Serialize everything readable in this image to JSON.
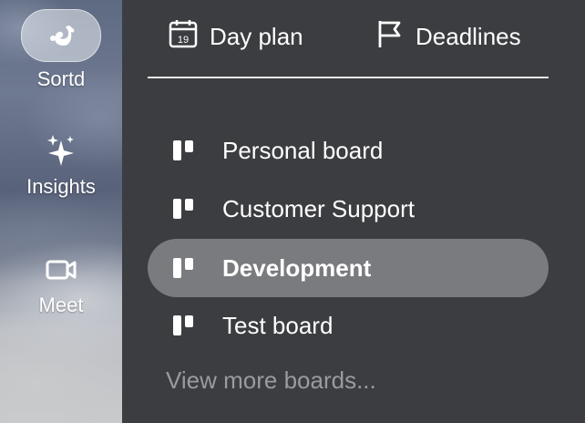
{
  "rail": {
    "items": [
      {
        "label": "Sortd",
        "icon": "squirrel-logo-icon"
      },
      {
        "label": "Insights",
        "icon": "sparkles-icon"
      },
      {
        "label": "Meet",
        "icon": "video-camera-icon"
      }
    ]
  },
  "tabs": [
    {
      "label": "Day plan",
      "icon": "calendar-icon",
      "calendar_day": "19"
    },
    {
      "label": "Deadlines",
      "icon": "flag-icon"
    }
  ],
  "boards": [
    {
      "label": "Personal board",
      "icon": "board-icon",
      "active": false
    },
    {
      "label": "Customer Support",
      "icon": "board-icon",
      "active": false
    },
    {
      "label": "Development",
      "icon": "board-icon",
      "active": true
    },
    {
      "label": "Test board",
      "icon": "board-icon",
      "active": false
    }
  ],
  "view_more": "View more boards...",
  "colors": {
    "panel_bg": "#3c3d41",
    "active_item_bg": "#7a7b7e",
    "muted_text": "#9a9b9f",
    "text": "#ffffff"
  }
}
